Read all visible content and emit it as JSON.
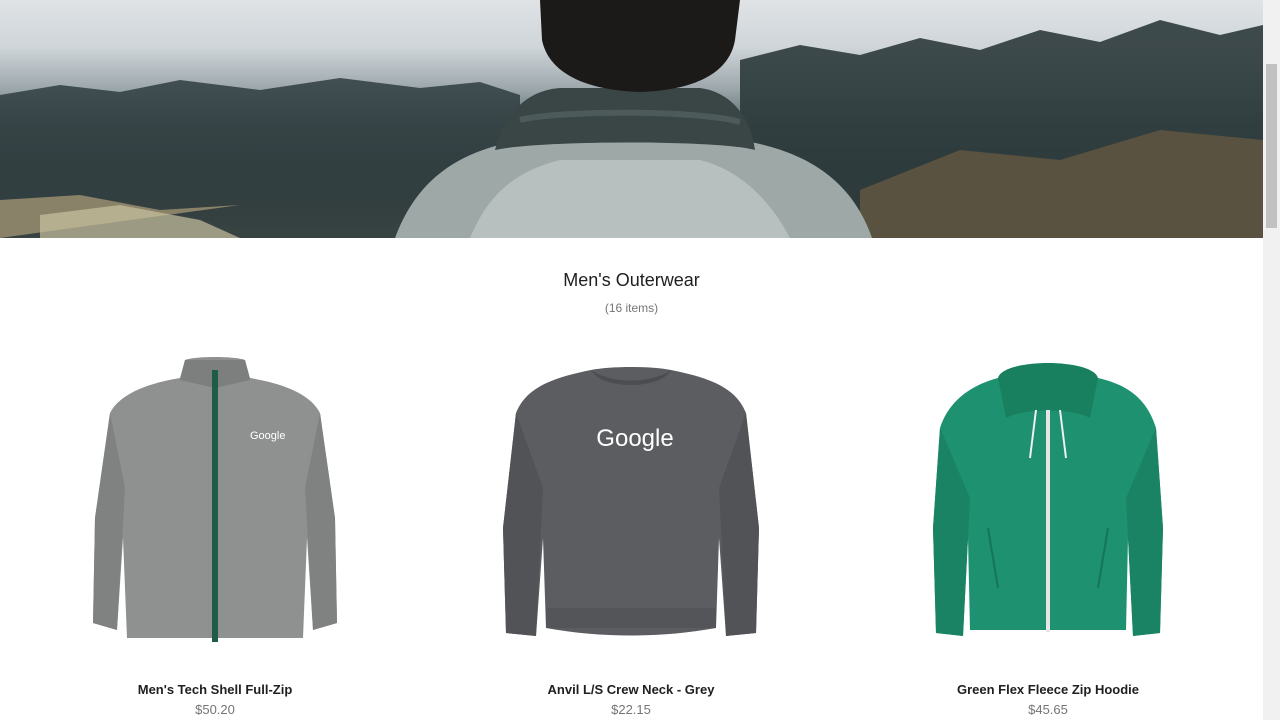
{
  "category": {
    "title": "Men's Outerwear",
    "count": "(16 items)"
  },
  "products": [
    {
      "name": "Men's Tech Shell Full-Zip",
      "price": "$50.20",
      "color": "#8e9190",
      "logo": "Google"
    },
    {
      "name": "Anvil L/S Crew Neck - Grey",
      "price": "$22.15",
      "color": "#5c5d60",
      "logo": "Google"
    },
    {
      "name": "Green Flex Fleece Zip Hoodie",
      "price": "$45.65",
      "color": "#1e9170",
      "logo": ""
    }
  ]
}
